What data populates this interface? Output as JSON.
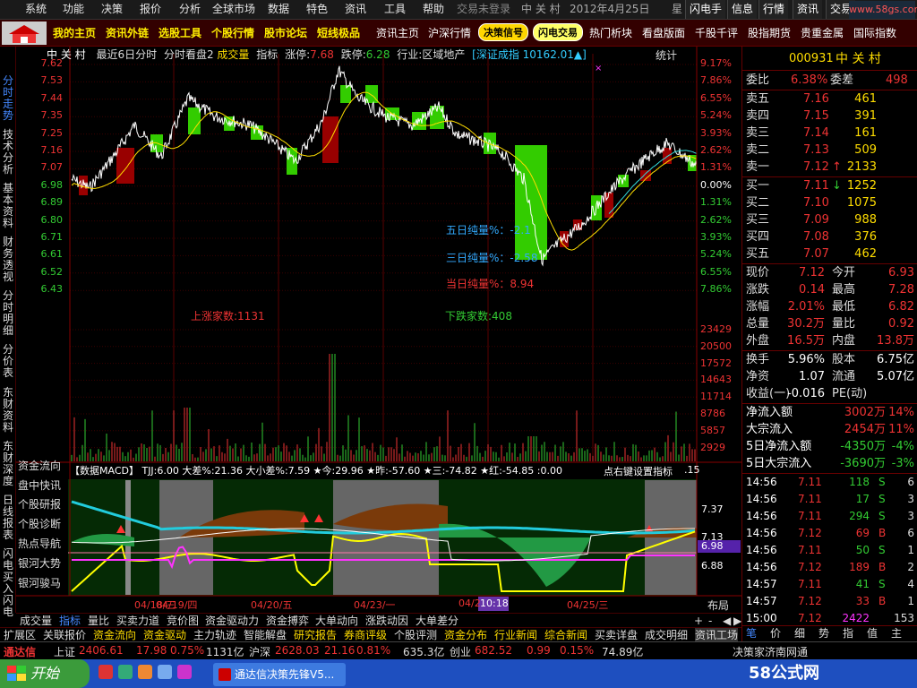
{
  "menu": {
    "items": [
      "系统",
      "功能",
      "决策",
      "报价",
      "分析",
      "全球市场",
      "数据",
      "特色",
      "资讯",
      "工具",
      "帮助"
    ],
    "status": "交易未登录",
    "stock_name": "中 关 村",
    "date": "2012年4月25日",
    "weekday": "星",
    "tools": [
      "闪电手",
      "信息",
      "行情",
      "资讯",
      "交易"
    ]
  },
  "toolbar": {
    "main_tabs": [
      "我的主页",
      "资讯外链",
      "选股工具",
      "个股行情",
      "股市论坛",
      "短线极品"
    ],
    "tabs2": [
      "资讯主页",
      "沪深行情"
    ],
    "pill1": "决策信号",
    "pill2": "闪电交易",
    "tabs3": [
      "热门析块",
      "看盘版面",
      "千股千评",
      "股指期货",
      "贵重金属",
      "国际指数"
    ]
  },
  "left_tabs": [
    "分时走势",
    "技术分析",
    "基本资料",
    "财务透视",
    "分时明细",
    "分价表",
    "东财资料",
    "东财深度",
    "日线报表",
    "闪电买入",
    "闪电"
  ],
  "chart": {
    "stock": "中 关 村",
    "mode": "最近6日分时",
    "kanpan": "分时看盘2",
    "cheng": "成交量",
    "zhibiao": "指标",
    "limit_up_label": "涨停:",
    "limit_up": "7.68",
    "limit_down_label": "跌停:",
    "limit_down": "6.28",
    "industry": "行业:区域地产",
    "index": "[深证成指 10162.01▲]",
    "tongji": "统计",
    "price_ticks": [
      "7.62",
      "7.53",
      "7.44",
      "7.35",
      "7.25",
      "7.16",
      "7.07",
      "6.98",
      "6.89",
      "6.80",
      "6.71",
      "6.61",
      "6.52",
      "6.43"
    ],
    "pct_ticks": [
      "9.17%",
      "7.86%",
      "6.55%",
      "5.24%",
      "3.93%",
      "2.62%",
      "1.31%",
      "0.00%",
      "1.31%",
      "2.62%",
      "3.93%",
      "5.24%",
      "6.55%",
      "7.86%"
    ],
    "vol_ticks": [
      "23429",
      "20500",
      "17572",
      "14643",
      "11714",
      "8786",
      "5857",
      "2929"
    ],
    "five_day": "五日纯量%：-2.1",
    "three_day": "三日纯量%：-2.58",
    "today": "当日纯量%：8.94",
    "up_count": "上涨家数:1131",
    "down_count": "下跌家数:408",
    "macd_header": "【数据MACD】 TJJ:6.00 大差%:21.36 大小差%:7.59 ★今:29.96 ★昨:-57.60 ★三:-74.82 ★红:-54.85 :0.00",
    "macd_header_right": "点右键设置指标",
    "macd_header_tail": ".15",
    "macd_ticks": [
      "7.37",
      "7.13",
      "6.98",
      "6.88"
    ],
    "date_labels": [
      "04/18/三",
      "04/19/四",
      "04/20/五",
      "04/23/一",
      "04/2",
      "04/25/三"
    ],
    "cursor_time": "10:18",
    "layout_label": "布局",
    "left_labels": [
      "资金流向",
      "盘中快讯",
      "个股研报",
      "个股诊断",
      "热点导航",
      "银河大势",
      "银河骏马"
    ]
  },
  "sub_tabs1": [
    "成交量",
    "指标",
    "量比",
    "买卖力道",
    "竞价图",
    "资金驱动力",
    "资金搏弈",
    "大单动向",
    "涨跌动因",
    "大单差分"
  ],
  "sub_tabs2": [
    "扩展区",
    "关联报价",
    "资金流向",
    "资金驱动",
    "主力轨迹",
    "智能解盘",
    "研究报告",
    "券商评级",
    "个股评测",
    "资金分布",
    "行业新闻",
    "综合新闻",
    "买卖详盘",
    "成交明细",
    "资讯工场"
  ],
  "pager": [
    "+",
    "-",
    "◀",
    "▶"
  ],
  "status_bar": {
    "app": "通达信",
    "sh_label": "上证",
    "sh_val": "2406.61",
    "sh_chg": "17.98",
    "sh_pct": "0.75%",
    "sh_amt": "1131亿",
    "sz_label": "沪深",
    "sz_val": "2628.03",
    "sz_chg": "21.16",
    "sz_pct": "0.81%",
    "sz_amt": "635.3亿",
    "cy_label": "创业",
    "cy_val": "682.52",
    "cy_chg": "0.99",
    "cy_pct": "0.15%",
    "cy_amt": "74.89亿",
    "broker": "决策家济南网通"
  },
  "taskbar": {
    "start": "开始",
    "window": "通达信决策先锋V5...",
    "watermark": "58公式网",
    "watermark_url": "www.58gs.com"
  },
  "quote": {
    "code": "000931",
    "name": "中 关 村",
    "weibi_label": "委比",
    "weibi": "6.38%",
    "weicha_label": "委差",
    "weicha": "498",
    "asks": [
      {
        "label": "卖五",
        "price": "7.16",
        "vol": "461"
      },
      {
        "label": "卖四",
        "price": "7.15",
        "vol": "391"
      },
      {
        "label": "卖三",
        "price": "7.14",
        "vol": "161"
      },
      {
        "label": "卖二",
        "price": "7.13",
        "vol": "509"
      },
      {
        "label": "卖一",
        "price": "7.12",
        "vol": "2133",
        "arrow": "↑"
      }
    ],
    "bids": [
      {
        "label": "买一",
        "price": "7.11",
        "vol": "1252",
        "arrow": "↓"
      },
      {
        "label": "买二",
        "price": "7.10",
        "vol": "1075"
      },
      {
        "label": "买三",
        "price": "7.09",
        "vol": "988"
      },
      {
        "label": "买四",
        "price": "7.08",
        "vol": "376"
      },
      {
        "label": "买五",
        "price": "7.07",
        "vol": "462"
      }
    ],
    "stats": [
      {
        "l1": "现价",
        "v1": "7.12",
        "l2": "今开",
        "v2": "6.93"
      },
      {
        "l1": "涨跌",
        "v1": "0.14",
        "l2": "最高",
        "v2": "7.28"
      },
      {
        "l1": "涨幅",
        "v1": "2.01%",
        "l2": "最低",
        "v2": "6.82"
      },
      {
        "l1": "总量",
        "v1": "30.2万",
        "l2": "量比",
        "v2": "0.92"
      },
      {
        "l1": "外盘",
        "v1": "16.5万",
        "l2": "内盘",
        "v2": "13.8万"
      }
    ],
    "stats2": [
      {
        "l1": "换手",
        "v1": "5.96%",
        "l2": "股本",
        "v2": "6.75亿"
      },
      {
        "l1": "净资",
        "v1": "1.07",
        "l2": "流通",
        "v2": "5.07亿"
      },
      {
        "l1": "收益(一)",
        "v1": "-0.016",
        "l2": "PE(动)",
        "v2": ""
      }
    ],
    "flows": [
      {
        "label": "净流入额",
        "v": "3002万",
        "p": "14%"
      },
      {
        "label": "大宗流入",
        "v": "2454万",
        "p": "11%"
      },
      {
        "label": "5日净流入额",
        "v": "-4350万",
        "p": "-4%"
      },
      {
        "label": "5日大宗流入",
        "v": "-3690万",
        "p": "-3%"
      }
    ],
    "ticks": [
      {
        "t": "14:56",
        "p": "7.11",
        "v": "118",
        "s": "S",
        "n": "6"
      },
      {
        "t": "14:56",
        "p": "7.11",
        "v": "17",
        "s": "S",
        "n": "3"
      },
      {
        "t": "14:56",
        "p": "7.11",
        "v": "294",
        "s": "S",
        "n": "3"
      },
      {
        "t": "14:56",
        "p": "7.12",
        "v": "69",
        "s": "B",
        "n": "6"
      },
      {
        "t": "14:56",
        "p": "7.11",
        "v": "50",
        "s": "S",
        "n": "1"
      },
      {
        "t": "14:56",
        "p": "7.12",
        "v": "189",
        "s": "B",
        "n": "2"
      },
      {
        "t": "14:57",
        "p": "7.11",
        "v": "41",
        "s": "S",
        "n": "4"
      },
      {
        "t": "14:57",
        "p": "7.12",
        "v": "33",
        "s": "B",
        "n": "1"
      },
      {
        "t": "15:00",
        "p": "7.12",
        "v": "2422",
        "s": "",
        "n": "153"
      }
    ],
    "bottom_tabs": [
      "笔",
      "价",
      "细",
      "势",
      "指",
      "值",
      "主"
    ]
  }
}
